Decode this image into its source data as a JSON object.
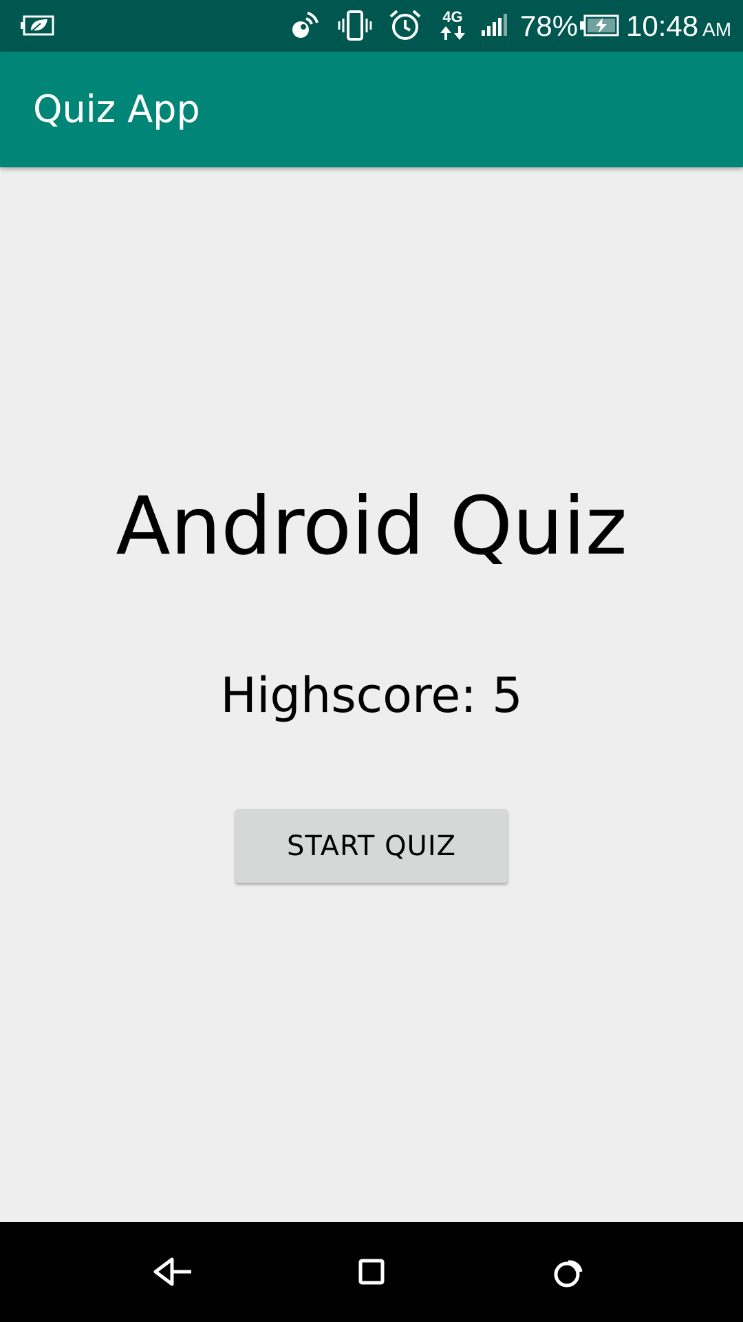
{
  "status_bar": {
    "battery_percent": "78%",
    "time": "10:48",
    "ampm": "AM",
    "network_type": "4G",
    "icons": [
      "battery-saver-icon",
      "hotspot-icon",
      "vibrate-icon",
      "alarm-icon",
      "data-4g-icon",
      "signal-icon",
      "battery-charging-icon"
    ]
  },
  "app_bar": {
    "title": "Quiz App"
  },
  "main": {
    "heading": "Android Quiz",
    "highscore": "Highscore: 5",
    "start_button_label": "START QUIZ"
  },
  "nav_bar": {
    "icons": [
      "back-icon",
      "home-icon",
      "recents-icon"
    ]
  },
  "colors": {
    "status_bar": "#00574f",
    "app_bar": "#008577",
    "background": "#eeeeee",
    "button": "#d6d7d7"
  }
}
